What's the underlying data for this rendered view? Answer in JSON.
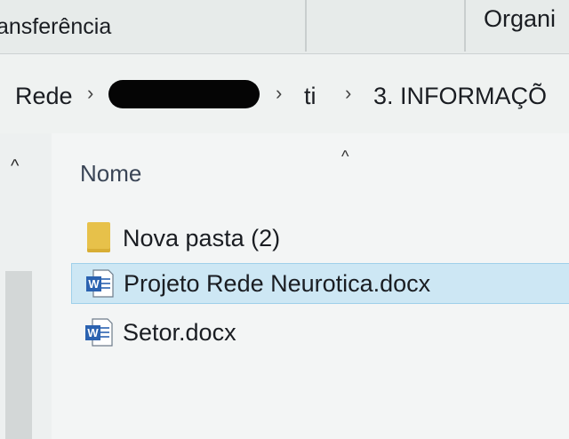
{
  "ribbon": {
    "left_label": "ansferência",
    "right_label": "Organi"
  },
  "address": {
    "crumbs": [
      "Rede",
      "ti",
      "3. INFORMAÇÕ"
    ],
    "chevron": "›"
  },
  "nav": {
    "up_glyph": "^"
  },
  "list": {
    "sort_glyph": "^",
    "column_header": "Nome",
    "items": [
      {
        "name": "Nova pasta (2)",
        "icon": "folder-icon",
        "selected": false
      },
      {
        "name": "Projeto Rede Neurotica.docx",
        "icon": "word-doc-icon",
        "selected": true
      },
      {
        "name": "Setor.docx",
        "icon": "word-doc-icon",
        "selected": false
      }
    ]
  },
  "colors": {
    "selection": "#cde7f4",
    "folder": "#e7c14a",
    "word_blue": "#2b62b0"
  }
}
